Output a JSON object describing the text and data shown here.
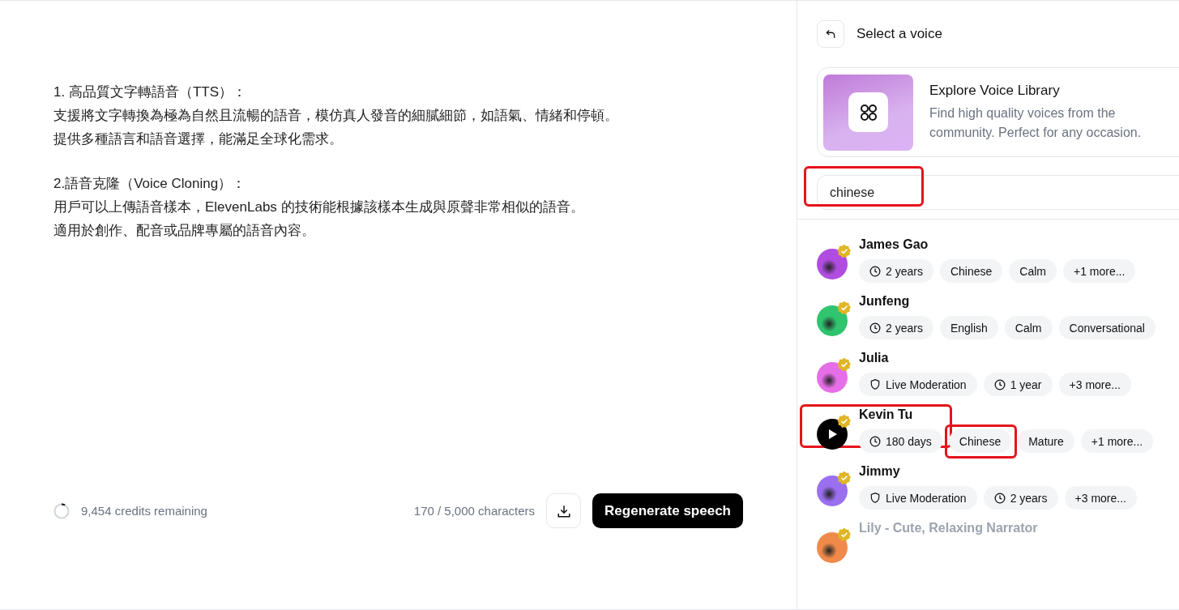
{
  "editor": {
    "paragraphs": [
      {
        "lines": [
          "1. 高品質文字轉語音（TTS）：",
          "支援將文字轉換為極為自然且流暢的語音，模仿真人發音的細膩細節，如語氣、情緒和停頓。",
          "提供多種語言和語音選擇，能滿足全球化需求。"
        ]
      },
      {
        "lines": [
          "2.語音克隆（Voice Cloning）：",
          "用戶可以上傳語音樣本，ElevenLabs 的技術能根據該樣本生成與原聲非常相似的語音。",
          "適用於創作、配音或品牌專屬的語音內容。"
        ]
      }
    ]
  },
  "footer": {
    "credits": "9,454 credits remaining",
    "characters": "170 / 5,000 characters",
    "primary_button": "Regenerate speech"
  },
  "panel": {
    "title": "Select a voice",
    "library": {
      "title": "Explore Voice Library",
      "description": "Find high quality voices from the community. Perfect for any occasion."
    },
    "search": {
      "value": "chinese",
      "highlighted": true
    },
    "voices": [
      {
        "name": "James Gao",
        "color": "#b04de0",
        "hovered": false,
        "highlighted": false,
        "faded": false,
        "tags": [
          {
            "kind": "age",
            "label": "2 years",
            "highlighted": false
          },
          {
            "kind": "plain",
            "label": "Chinese",
            "highlighted": false
          },
          {
            "kind": "plain",
            "label": "Calm",
            "highlighted": false
          },
          {
            "kind": "plain",
            "label": "+1 more...",
            "highlighted": false
          }
        ]
      },
      {
        "name": "Junfeng",
        "color": "#2fc46e",
        "hovered": false,
        "highlighted": false,
        "faded": false,
        "tags": [
          {
            "kind": "age",
            "label": "2 years",
            "highlighted": false
          },
          {
            "kind": "plain",
            "label": "English",
            "highlighted": false
          },
          {
            "kind": "plain",
            "label": "Calm",
            "highlighted": false
          },
          {
            "kind": "plain",
            "label": "Conversational",
            "highlighted": false
          }
        ]
      },
      {
        "name": "Julia",
        "color": "#e66ee8",
        "hovered": false,
        "highlighted": false,
        "faded": false,
        "tags": [
          {
            "kind": "moderation",
            "label": "Live Moderation",
            "highlighted": false
          },
          {
            "kind": "age",
            "label": "1 year",
            "highlighted": false
          },
          {
            "kind": "plain",
            "label": "+3 more...",
            "highlighted": false
          }
        ]
      },
      {
        "name": "Kevin Tu",
        "hovered": true,
        "highlighted": true,
        "faded": false,
        "tags": [
          {
            "kind": "age",
            "label": "180 days",
            "highlighted": false
          },
          {
            "kind": "plain",
            "label": "Chinese",
            "highlighted": true
          },
          {
            "kind": "plain",
            "label": "Mature",
            "highlighted": false
          },
          {
            "kind": "plain",
            "label": "+1 more...",
            "highlighted": false
          }
        ]
      },
      {
        "name": "Jimmy",
        "color": "#9a6ff0",
        "hovered": false,
        "highlighted": false,
        "faded": false,
        "tags": [
          {
            "kind": "moderation",
            "label": "Live Moderation",
            "highlighted": false
          },
          {
            "kind": "age",
            "label": "2 years",
            "highlighted": false
          },
          {
            "kind": "plain",
            "label": "+3 more...",
            "highlighted": false
          }
        ]
      },
      {
        "name": "Lily - Cute, Relaxing Narrator",
        "color": "#f08a4a",
        "hovered": false,
        "highlighted": false,
        "faded": true
      }
    ]
  }
}
